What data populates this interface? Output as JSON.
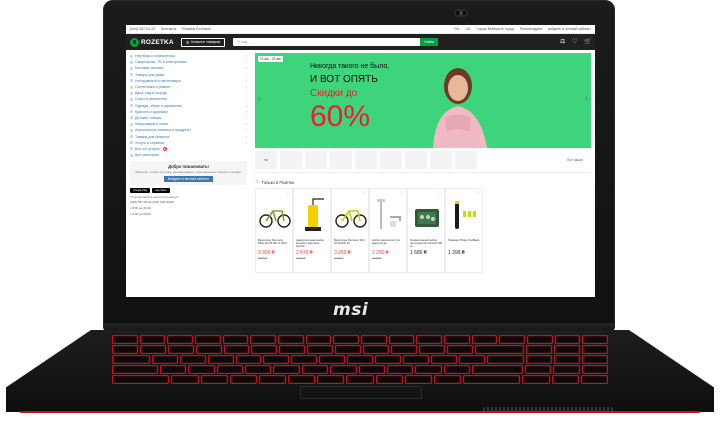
{
  "laptop": {
    "brand": "msi"
  },
  "topline": {
    "phone": "(044) 537-02-22",
    "links": [
      "Контакты",
      "Rozetka Exclusive"
    ],
    "lang": [
      "RU",
      "UA"
    ],
    "city": "Город: Выберите город",
    "region": "Рекомендуем",
    "account": "войдите в личный кабинет"
  },
  "header": {
    "logo": "ROZETKA",
    "catalog": "Каталог товаров",
    "search_placeholder": "Я ищу...",
    "search_button": "Найти"
  },
  "sidebar": {
    "items": [
      {
        "label": "Ноутбуки и компьютеры"
      },
      {
        "label": "Смартфоны, ТВ и электроника"
      },
      {
        "label": "Бытовая техника"
      },
      {
        "label": "Товары для дома"
      },
      {
        "label": "Инструменты и автотовары"
      },
      {
        "label": "Сантехника и ремонт"
      },
      {
        "label": "Дача, сад и огород"
      },
      {
        "label": "Спорт и увлечения"
      },
      {
        "label": "Одежда, обувь и украшения"
      },
      {
        "label": "Красота и здоровье"
      },
      {
        "label": "Детские товары"
      },
      {
        "label": "Канцтовары и книги"
      },
      {
        "label": "Алкогольные напитки и продукты"
      },
      {
        "label": "Товары для бизнеса"
      },
      {
        "label": "Услуги и сервисы"
      },
      {
        "label": "Все что угодно"
      },
      {
        "label": "Все категории"
      }
    ],
    "welcome_title": "Добро пожаловать!",
    "welcome_sub": "Войдите, чтобы получать рекомендации, персональные бонусы и скидки.",
    "login_button": "Войдите в личный кабинет",
    "stores": [
      "Google Play",
      "App Store"
    ],
    "apps_note": "Устанавливайте наши приложения",
    "support": "(044) 537-02-22   (044) 503-80-80",
    "hours": [
      "с 8:00 до 21:00",
      "с 9:00 до 20:00"
    ]
  },
  "banner": {
    "date": "22 авг - 29 авг",
    "line1": "Никогда такого не было,",
    "line2": "И ВОТ ОПЯТЬ",
    "line3": "Скидки до",
    "line4": "60%"
  },
  "strip": {
    "items": [
      "50",
      "",
      "",
      "",
      "",
      "",
      "",
      "",
      ""
    ],
    "more": "Все акции"
  },
  "section": {
    "title": "Только в Розетке"
  },
  "products": [
    {
      "name": "Велосипед Discovery Rider AM 26 DD 17 2019",
      "price": "3 999 ₴",
      "old": "5 899 ₴",
      "red": true
    },
    {
      "name": "Аккумуляторная мойка высокого давления Karcher",
      "price": "2 679 ₴",
      "old": "3 399 ₴",
      "red": true
    },
    {
      "name": "Велосипед Discovery Flint 26 AM DD 19",
      "price": "3 269 ₴",
      "old": "4 399 ₴",
      "red": true
    },
    {
      "name": "Набор смесителей для ванны Q-tap",
      "price": "2 250 ₴",
      "old": "2 999 ₴",
      "red": true
    },
    {
      "name": "Универсальный набор инструментов Intertool 108 эл.",
      "price": "1 680 ₴",
      "old": "",
      "red": false
    },
    {
      "name": "Триммер Philips OneBlade",
      "price": "1 399 ₴",
      "old": "",
      "red": false
    }
  ]
}
